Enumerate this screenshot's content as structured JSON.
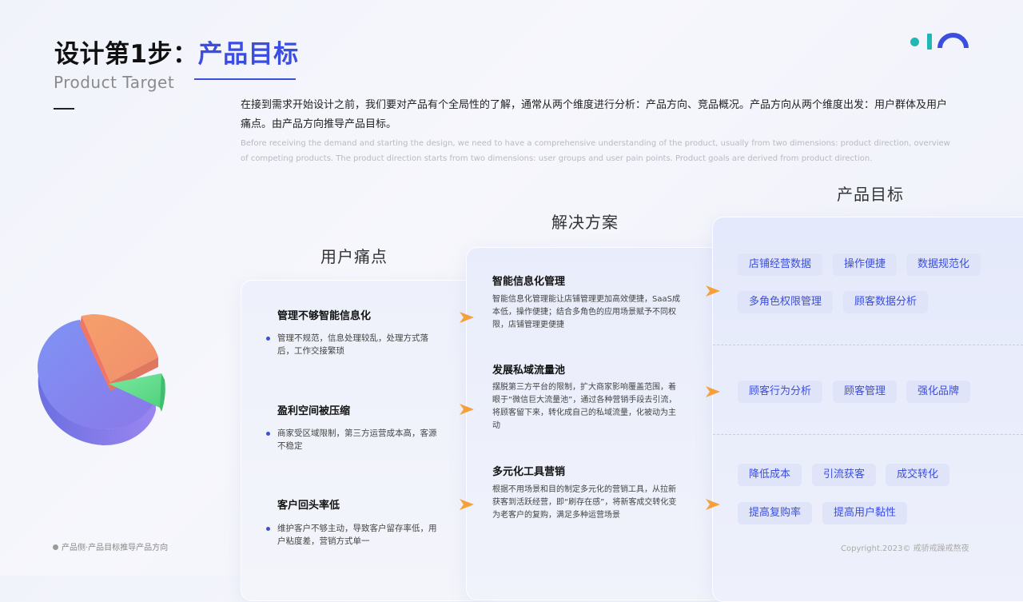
{
  "header": {
    "title_prefix": "设计第1步：",
    "title_accent": "产品目标",
    "subtitle": "Product Target"
  },
  "intro": {
    "cn": "在接到需求开始设计之前，我们要对产品有个全局性的了解，通常从两个维度进行分析：产品方向、竞品概况。产品方向从两个维度出发：用户群体及用户痛点。由产品方向推导产品目标。",
    "en": "Before receiving the demand and starting the design, we need to have a comprehensive understanding of the product, usually from two dimensions: product direction, overview of competing products. The product direction starts from two dimensions: user groups and user pain points. Product goals are derived from product direction."
  },
  "columns": {
    "pain_title": "用户痛点",
    "solution_title": "解决方案",
    "goal_title": "产品目标"
  },
  "pain_points": [
    {
      "title": "管理不够智能信息化",
      "desc": "管理不规范，信息处理较乱，处理方式落后，工作交接繁琐"
    },
    {
      "title": "盈利空间被压缩",
      "desc": "商家受区域限制，第三方运营成本高，客源不稳定"
    },
    {
      "title": "客户回头率低",
      "desc": "维护客户不够主动，导致客户留存率低，用户粘度差，营销方式单一"
    }
  ],
  "solutions": [
    {
      "title": "智能信息化管理",
      "desc": "智能信息化管理能让店铺管理更加高效便捷，SaaS成本低，操作便捷；结合多角色的应用场景赋予不同权限，店铺管理更便捷"
    },
    {
      "title": "发展私域流量池",
      "desc": "摆脱第三方平台的限制，扩大商家影响覆盖范围，着眼于“微信巨大流量池”，通过各种营销手段去引流，将顾客留下来，转化成自己的私域流量，化被动为主动"
    },
    {
      "title": "多元化工具营销",
      "desc": "根据不用场景和目的制定多元化的营销工具，从拉新获客到活跃经营，即“刷存在感”，将新客成交转化变为老客户的复购，满足多种运营场景"
    }
  ],
  "goals": {
    "group1": [
      "店铺经营数据",
      "操作便捷",
      "数据规范化",
      "多角色权限管理",
      "顾客数据分析"
    ],
    "group2": [
      "顾客行为分析",
      "顾客管理",
      "强化品牌"
    ],
    "group3": [
      "降低成本",
      "引流获客",
      "成交转化",
      "提高复购率",
      "提高用户黏性"
    ]
  },
  "footer": {
    "left": "产品侧·产品目标推导产品方向",
    "right": "Copyright.2023© 戒骄戒躁戒熬夜"
  },
  "colors": {
    "accent": "#3b4ee0",
    "logo_teal": "#1fb8b4",
    "arrow_orange": "#f5a03a"
  },
  "icons": [
    "logo-mark",
    "pie-chart-illustration",
    "arrow-right-icon",
    "bullet-dot-icon"
  ]
}
